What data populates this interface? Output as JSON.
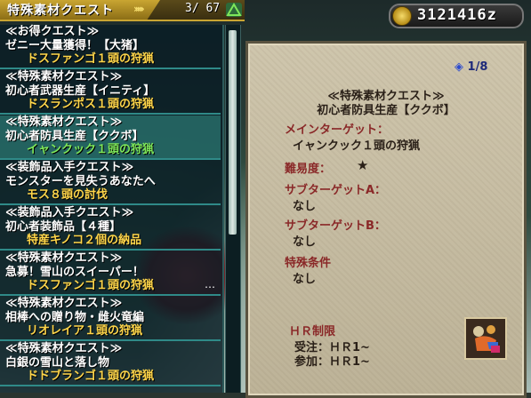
{
  "header": {
    "title": "特殊素材クエスト",
    "count": "3/ 67"
  },
  "zenny": {
    "amount": "3121416z"
  },
  "quests": [
    {
      "type": "≪お得クエスト≫",
      "name": "ゼニー大量獲得！【大猪】",
      "goal": "ドスファンゴ１頭の狩猟",
      "goal_color": "yellow"
    },
    {
      "type": "≪特殊素材クエスト≫",
      "name": "初心者武器生産【イニティ】",
      "goal": "ドスランポス１頭の狩猟",
      "goal_color": "yellow"
    },
    {
      "type": "≪特殊素材クエスト≫",
      "name": "初心者防具生産【ククボ】",
      "goal": "イャンクック１頭の狩猟",
      "goal_color": "green"
    },
    {
      "type": "≪装飾品入手クエスト≫",
      "name": "モンスターを見失うあなたへ",
      "goal": "モス８頭の討伐",
      "goal_color": "yellow"
    },
    {
      "type": "≪装飾品入手クエスト≫",
      "name": "初心者装飾品【４種】",
      "goal": "特産キノコ２個の納品",
      "goal_color": "yellow"
    },
    {
      "type": "≪特殊素材クエスト≫",
      "name": "急募！雪山のスイーパー！",
      "goal": "ドスファンゴ１頭の狩猟",
      "goal_color": "yellow",
      "more": "…"
    },
    {
      "type": "≪特殊素材クエスト≫",
      "name": "相棒への贈り物・雌火竜編",
      "goal": "リオレイア１頭の狩猟",
      "goal_color": "yellow"
    },
    {
      "type": "≪特殊素材クエスト≫",
      "name": "白銀の雪山と落し物",
      "goal": "ドドブランゴ１頭の狩猟",
      "goal_color": "yellow"
    }
  ],
  "selected_index": 2,
  "detail": {
    "page": "1/8",
    "quest_type": "≪特殊素材クエスト≫",
    "quest_name": "初心者防具生産【ククボ】",
    "main_target_label": "メインターゲット：",
    "main_target": "イャンクック１頭の狩猟",
    "difficulty_label": "難易度：",
    "difficulty": "★",
    "sub_a_label": "サブターゲットA：",
    "sub_a": "なし",
    "sub_b_label": "サブターゲットB：",
    "sub_b": "なし",
    "special_label": "特殊条件",
    "special": "なし",
    "hr_title": "ＨＲ制限",
    "hr_accept": "受注：ＨＲ1~",
    "hr_join": "参加：ＨＲ1~"
  },
  "colors": {
    "goal_yellow": "#ffd64a",
    "goal_green": "#7ee85a",
    "label_red": "#8a2828"
  }
}
